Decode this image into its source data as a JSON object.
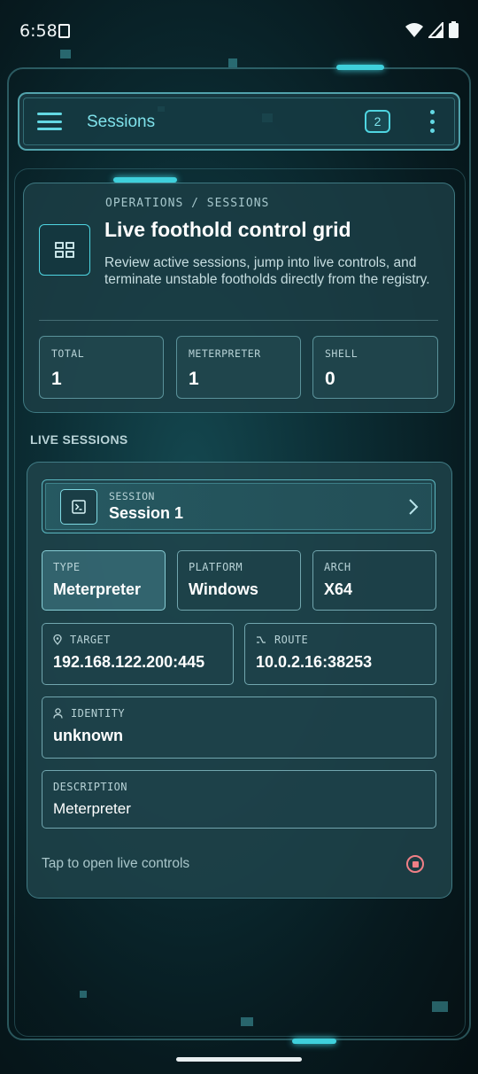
{
  "status_bar": {
    "time": "6:58",
    "icons": [
      "sim-card-icon",
      "wifi-icon",
      "signal-icon",
      "battery-icon"
    ]
  },
  "app_bar": {
    "title": "Sessions",
    "badge_count": "2",
    "menu_icon": "hamburger-menu-icon",
    "more_icon": "more-vert-icon"
  },
  "header": {
    "breadcrumb": "OPERATIONS / SESSIONS",
    "title": "Live foothold control grid",
    "description": "Review active sessions, jump into live controls, and terminate unstable footholds directly from the registry.",
    "icon": "grid-icon",
    "stats": [
      {
        "label": "TOTAL",
        "value": "1"
      },
      {
        "label": "METERPRETER",
        "value": "1"
      },
      {
        "label": "SHELL",
        "value": "0"
      }
    ]
  },
  "live_sessions": {
    "section_label": "LIVE SESSIONS",
    "session": {
      "kicker": "SESSION",
      "name": "Session 1",
      "icon": "terminal-icon",
      "type_label": "TYPE",
      "type_value": "Meterpreter",
      "platform_label": "PLATFORM",
      "platform_value": "Windows",
      "arch_label": "ARCH",
      "arch_value": "X64",
      "target_label": "TARGET",
      "target_value": "192.168.122.200:445",
      "route_label": "ROUTE",
      "route_value": "10.0.2.16:38253",
      "identity_label": "IDENTITY",
      "identity_value": "unknown",
      "description_label": "DESCRIPTION",
      "description_value": "Meterpreter",
      "hint": "Tap to open live controls"
    }
  },
  "colors": {
    "accent": "#4fd5e1",
    "danger": "#f07f86",
    "background": "#0c2f36"
  }
}
